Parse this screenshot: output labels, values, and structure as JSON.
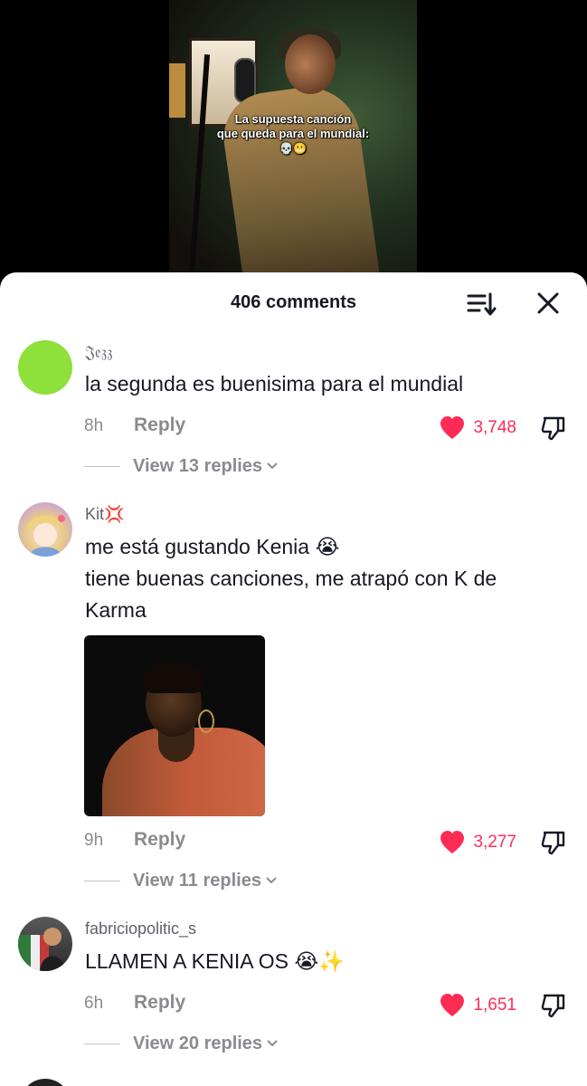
{
  "video": {
    "caption_line1": "La supuesta canción",
    "caption_line2": "que queda para el mundial:",
    "caption_emojis": "💀😬"
  },
  "sheet": {
    "comment_count": "406 comments",
    "sort_icon": "sort-lines-icon",
    "close_icon": "close-icon"
  },
  "comments": [
    {
      "username": "𝔍𝔢𝔷𝔷",
      "text": "la segunda es buenisima para el mundial",
      "time": "8h",
      "reply_label": "Reply",
      "likes": "3,748",
      "view_replies": "View 13 replies",
      "avatar_color": "#8ee03a"
    },
    {
      "username": "Kit💢",
      "text_line1": "me está gustando Kenia 😭",
      "text_line2": "tiene buenas canciones, me atrapó con K de",
      "text_line3": "Karma",
      "time": "9h",
      "reply_label": "Reply",
      "likes": "3,277",
      "view_replies": "View 11 replies"
    },
    {
      "username": "fabriciopolitic_s",
      "text": "LLAMEN A KENIA OS 😭✨",
      "time": "6h",
      "reply_label": "Reply",
      "likes": "1,651",
      "view_replies": "View 20 replies"
    }
  ],
  "colors": {
    "like_red": "#fe2c55",
    "text_dark": "#161823",
    "text_gray": "#8a8b91"
  }
}
